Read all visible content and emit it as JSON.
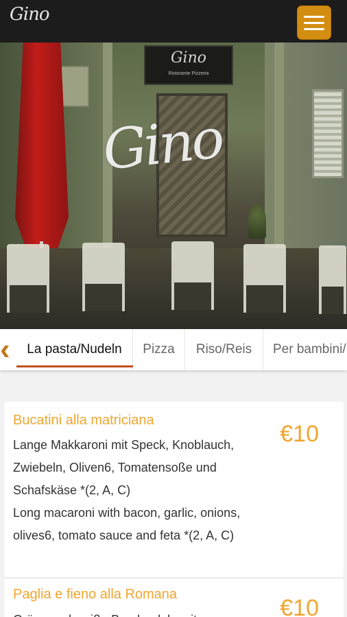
{
  "header": {
    "logo_text": "Gino",
    "menu_icon": "hamburger-menu-icon"
  },
  "hero": {
    "sign_text": "Gino",
    "sign_subtitle": "Ristorante Pizzeria",
    "script_logo": "Gino"
  },
  "tabs": {
    "items": [
      {
        "label": "La pasta/Nudeln",
        "active": true
      },
      {
        "label": "Pizza",
        "active": false
      },
      {
        "label": "Riso/Reis",
        "active": false
      },
      {
        "label": "Per bambini/",
        "active": false
      }
    ],
    "prev_icon": "chevron-left-icon",
    "accent_color": "#c0501c"
  },
  "menu": {
    "items": [
      {
        "title": "Bucatini alla matriciana",
        "price": "€10",
        "desc_de": "Lange Makkaroni mit Speck, Knoblauch, Zwiebeln, Oliven6, Tomatensoße und Schafskäse *(2, A, C)",
        "desc_en": "Long macaroni with bacon, garlic, onions, olives6, tomato sauce and feta *(2, A, C)"
      },
      {
        "title": "Paglia e fieno alla Romana",
        "price": "€10",
        "desc_de": "Grüne und weiße Bandnudeln mit"
      }
    ],
    "accent_color": "#f0a630"
  }
}
